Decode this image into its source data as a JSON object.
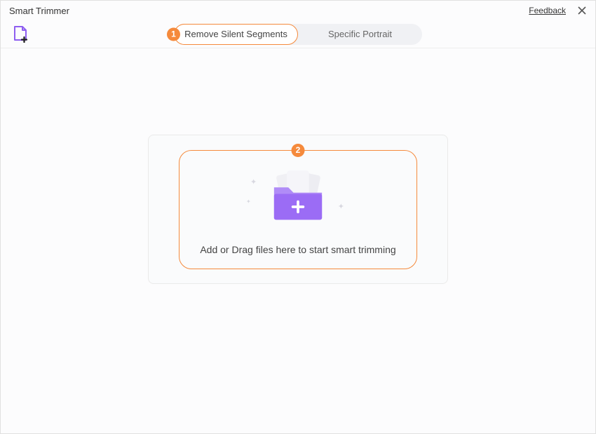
{
  "window": {
    "title": "Smart Trimmer",
    "feedback_label": "Feedback"
  },
  "tabs": {
    "remove_silent": "Remove Silent Segments",
    "specific_portrait": "Specific Portrait"
  },
  "steps": {
    "one": "1",
    "two": "2"
  },
  "dropzone": {
    "text": "Add or Drag files here to start smart trimming"
  },
  "colors": {
    "accent": "#f58a3c",
    "folder": "#9b6cf5"
  }
}
